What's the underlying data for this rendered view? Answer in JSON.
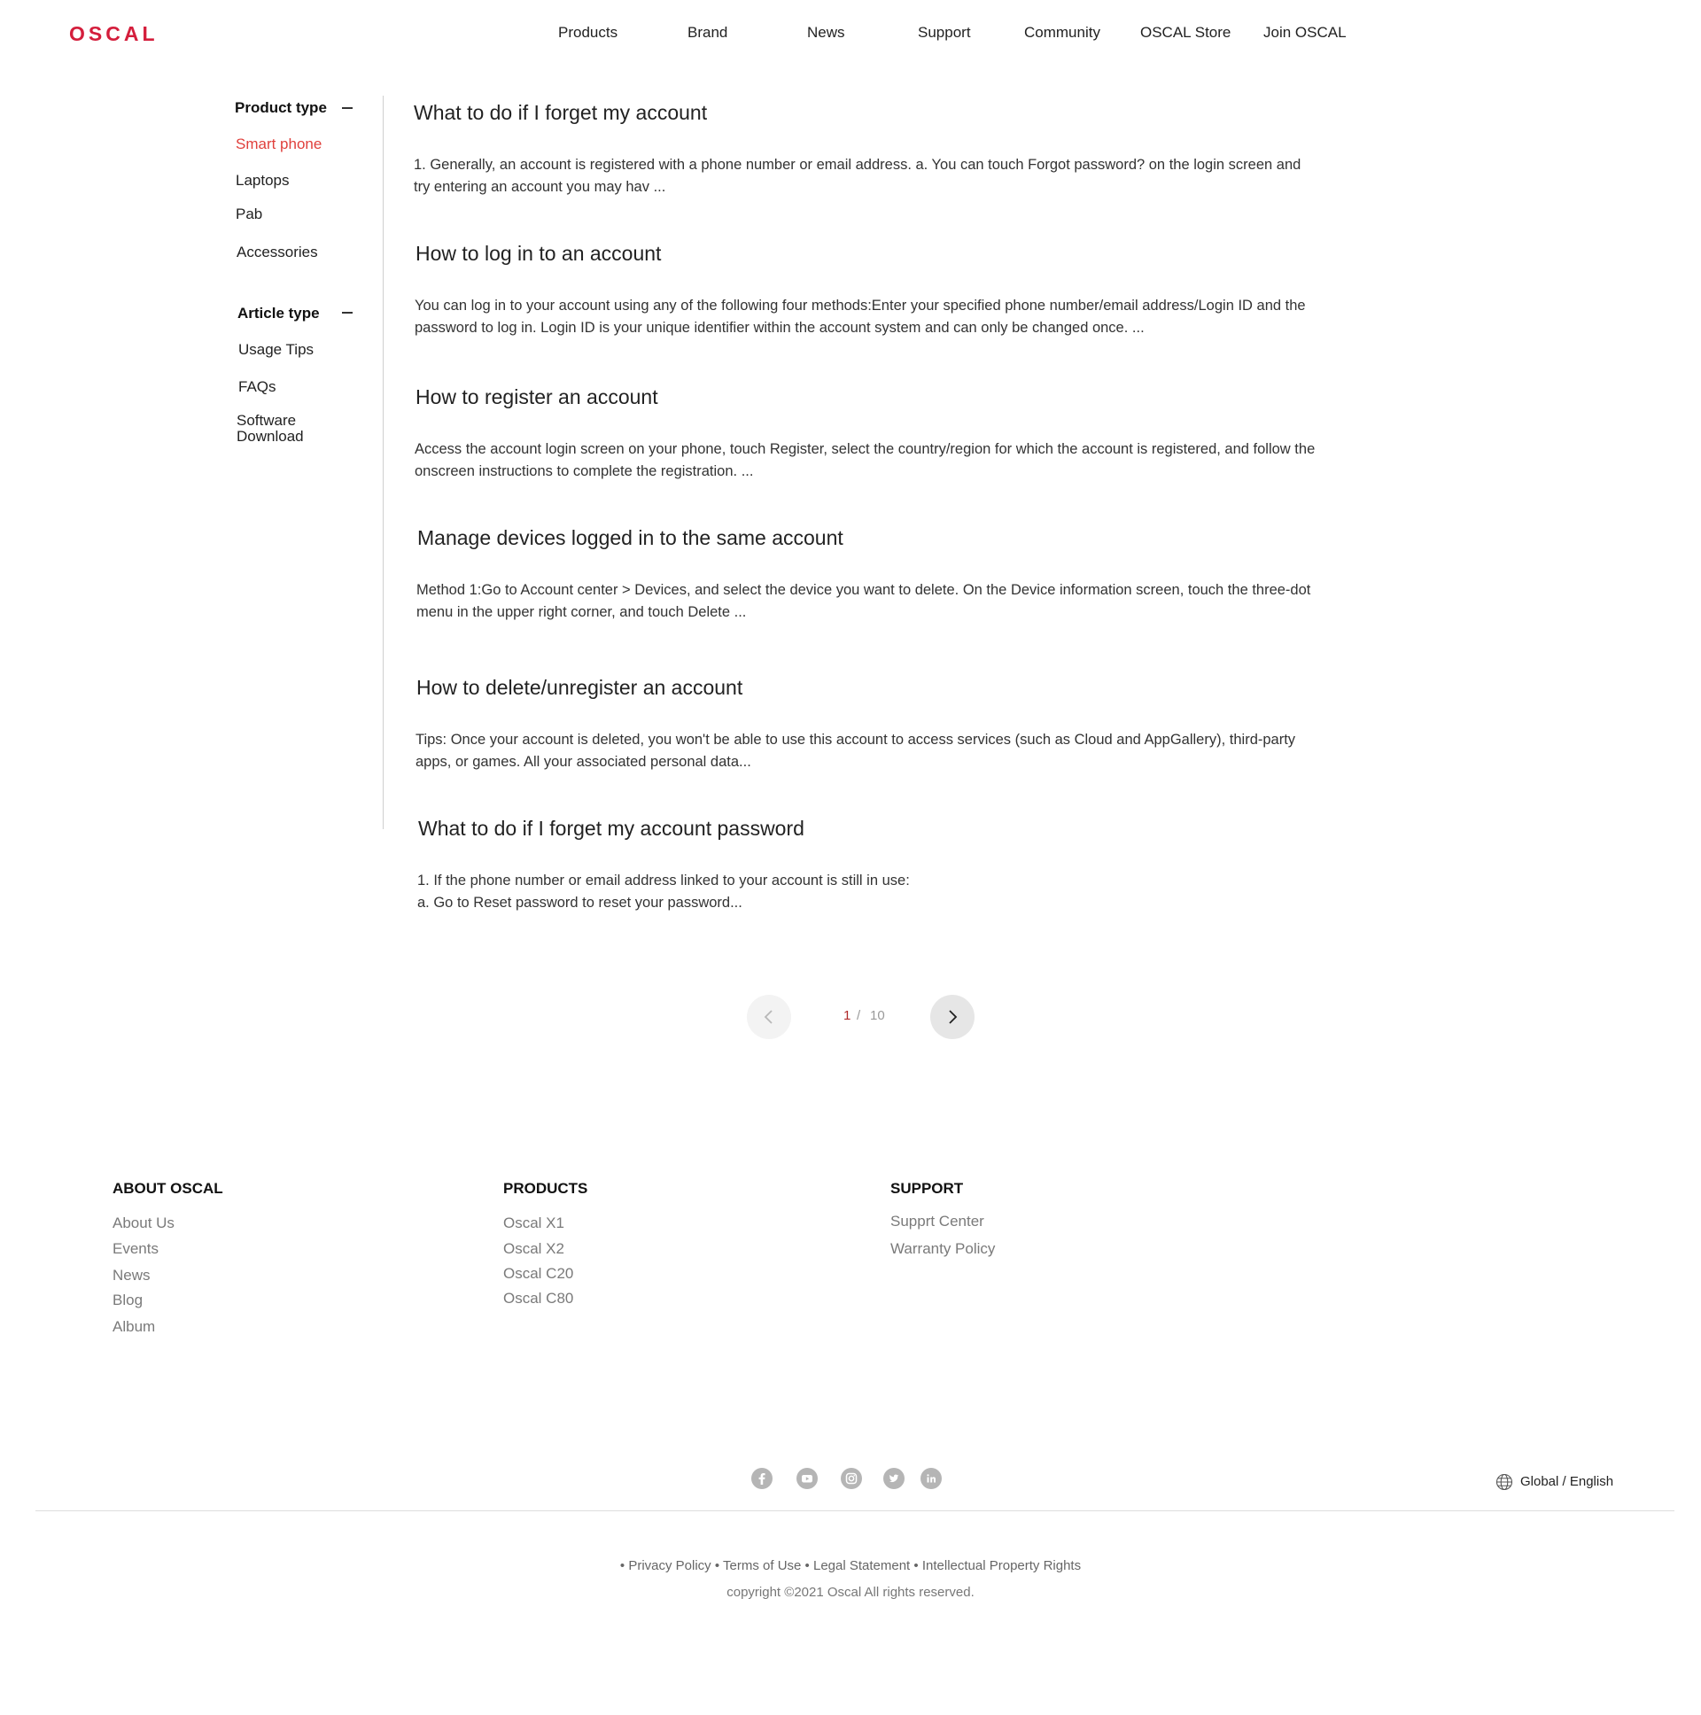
{
  "brand": {
    "logo_text": "OSCAL",
    "accent_color": "#d41e3c"
  },
  "nav": {
    "products": "Products",
    "brand": "Brand",
    "news": "News",
    "support": "Support",
    "community": "Community",
    "store": "OSCAL Store",
    "join": "Join OSCAL"
  },
  "sidebar": {
    "product_type": {
      "heading": "Product type",
      "items": [
        "Smart phone",
        "Laptops",
        "Pab",
        "Accessories"
      ],
      "active": "Smart phone"
    },
    "article_type": {
      "heading": "Article type",
      "items": [
        "Usage Tips",
        "FAQs",
        "Software Download"
      ]
    }
  },
  "articles": [
    {
      "title": "What to do if I forget my account",
      "body": "1. Generally, an account is registered with a phone number or email address. a. You can touch Forgot password? on the login screen and try entering an account you may hav ..."
    },
    {
      "title": "How to log in to an account",
      "body": "You can log in to your account using any of the following four methods:Enter your specified phone number/email address/Login ID and the password to log in. Login ID is your unique identifier within the account system and can only be changed once. ..."
    },
    {
      "title": "How to register an account",
      "body": "Access the account login screen on your phone, touch Register, select the country/region for which the account is registered, and follow the onscreen instructions to complete the registration. ..."
    },
    {
      "title": "Manage devices logged in to the same account",
      "body": "Method 1:Go to Account center > Devices, and select the device you want to delete. On the Device information screen, touch the three-dot menu in the upper right corner, and touch Delete ..."
    },
    {
      "title": "How to delete/unregister an account",
      "body": "Tips: Once your account is deleted, you won't be able to use this account to access services (such as Cloud and AppGallery), third-party apps, or games. All your associated personal data..."
    },
    {
      "title": "What to do if I forget my account password",
      "body_line1": "1. If the phone number or email address linked to your account is still in use:",
      "body_line2": "a. Go to Reset password to reset your password..."
    }
  ],
  "pagination": {
    "current": "1",
    "separator": "/",
    "total": "10"
  },
  "footer": {
    "about": {
      "heading": "ABOUT OSCAL",
      "links": [
        "About Us",
        "Events",
        "News",
        "Blog",
        "Album"
      ]
    },
    "products": {
      "heading": "PRODUCTS",
      "links": [
        "Oscal X1",
        "Oscal X2",
        "Oscal C20",
        "Oscal C80"
      ]
    },
    "support": {
      "heading": "SUPPORT",
      "links": [
        "Supprt Center",
        "Warranty Policy"
      ]
    },
    "social_icons": [
      "facebook-icon",
      "youtube-icon",
      "instagram-icon",
      "twitter-icon",
      "linkedin-icon"
    ],
    "language": "Global / English",
    "legal_links": [
      "Privacy Policy",
      "Terms of Use",
      "Legal Statement",
      "Intellectual Property Rights"
    ],
    "bullet": "•",
    "copyright": "copyright ©2021 Oscal All rights reserved."
  }
}
